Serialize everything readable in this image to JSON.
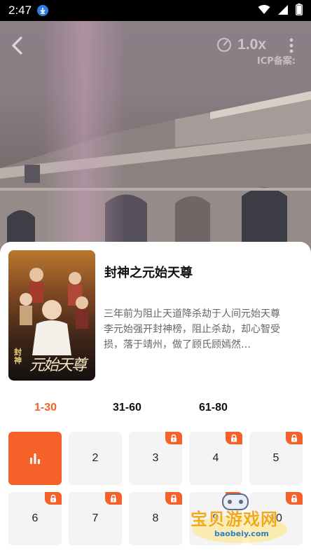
{
  "status_bar": {
    "time": "2:47"
  },
  "player": {
    "speed_label": "1.0x",
    "icp_label": "ICP备案:"
  },
  "drama": {
    "title": "封神之元始天尊",
    "description": "三年前为阻止天道降杀劫于人间元始天尊李元始强开封神榜，阻止杀劫，却心智受损，落于靖州，做了顾氏顾嫣然…",
    "poster_caption": "元始天尊",
    "poster_badge": "封神"
  },
  "range_tabs": [
    {
      "label": "1-30",
      "active": true
    },
    {
      "label": "31-60",
      "active": false
    },
    {
      "label": "61-80",
      "active": false
    }
  ],
  "episodes": [
    {
      "label": "",
      "playing": true,
      "locked": false
    },
    {
      "label": "2",
      "playing": false,
      "locked": false
    },
    {
      "label": "3",
      "playing": false,
      "locked": true
    },
    {
      "label": "4",
      "playing": false,
      "locked": true
    },
    {
      "label": "5",
      "playing": false,
      "locked": true
    },
    {
      "label": "6",
      "playing": false,
      "locked": true
    },
    {
      "label": "7",
      "playing": false,
      "locked": true
    },
    {
      "label": "8",
      "playing": false,
      "locked": true
    },
    {
      "label": "9",
      "playing": false,
      "locked": true
    },
    {
      "label": "10",
      "playing": false,
      "locked": true
    }
  ],
  "watermark": {
    "text": "宝贝游戏网",
    "url": "baobeiy.com"
  },
  "colors": {
    "accent": "#f4622a",
    "cell_bg": "#f4f4f4"
  }
}
